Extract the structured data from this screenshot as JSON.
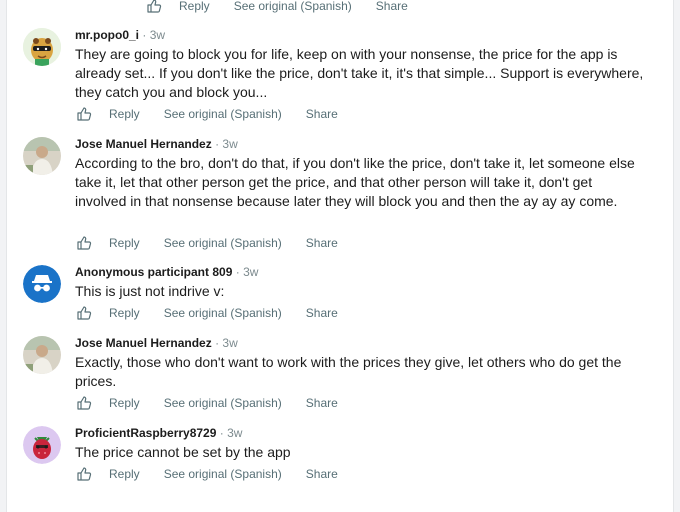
{
  "actions": {
    "reply": "Reply",
    "see_original": "See original (Spanish)",
    "share": "Share"
  },
  "comments": [
    {
      "author": "mr.popo0_i",
      "time": "3w",
      "text": "They are going to block you for life, keep on with your nonsense, the price for the app is already set... If you don't like the price, don't take it, it's that simple... Support is everywhere, they catch you and block you..."
    },
    {
      "author": "Jose Manuel Hernandez",
      "time": "3w",
      "text": "According to the bro, don't do that, if you don't like the price, don't take it, let someone else take it, let that other person get the price, and that other person will take it, don't get involved in that nonsense because later they will block you and then the ay ay ay come."
    },
    {
      "author": "Anonymous participant 809",
      "time": "3w",
      "text": "This is just not indrive v:"
    },
    {
      "author": "Jose Manuel Hernandez",
      "time": "3w",
      "text": "Exactly, those who don't want to work with the prices they give, let others who do get the prices."
    },
    {
      "author": "ProficientRaspberry8729",
      "time": "3w",
      "text": "The price cannot be set by the app"
    }
  ],
  "colors": {
    "meta": "#7c8a8e",
    "action": "#576f76",
    "anon_avatar": "#1a73c8",
    "raspberry_avatar_bg": "#dcc8f0"
  }
}
